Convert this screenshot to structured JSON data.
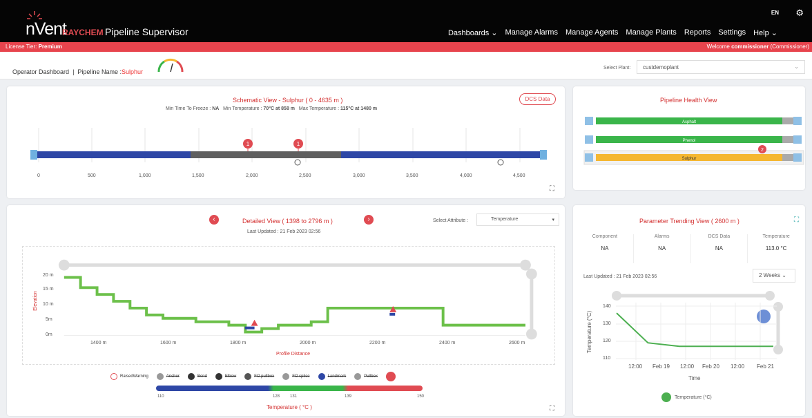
{
  "header": {
    "brand": "nVent",
    "raychem": "RAYCHEM",
    "product": "Pipeline Supervisor",
    "nav": [
      "Dashboards ⌄",
      "Manage Alarms",
      "Manage Agents",
      "Manage Plants",
      "Reports",
      "Settings",
      "Help ⌄"
    ],
    "lang": "EN"
  },
  "license": {
    "label": "License Tier:",
    "tier": "Premium",
    "welcome": "Welcome",
    "user": "commissioner",
    "role": "(Commissioner)"
  },
  "breadcrumb": {
    "dashboard": "Operator Dashboard",
    "sep": "|",
    "pipeline_label": "Pipeline Name :",
    "pipeline": "Sulphur"
  },
  "plant": {
    "label": "Select Plant:",
    "value": "custdemoplant"
  },
  "schematic": {
    "title": "Schematic View - Sulphur ( 0 - 4635 m )",
    "min_freeze_label": "Min Time To Freeze :",
    "min_freeze": "NA",
    "min_temp_label": "Min Temperature :",
    "min_temp": "70°C at 858 m",
    "max_temp_label": "Max Temperature :",
    "max_temp": "115°C at 1480 m",
    "dcs_button": "DCS Data",
    "ticks": [
      "0",
      "500",
      "1,000",
      "1,500",
      "2,000",
      "2,500",
      "3,000",
      "3,500",
      "4,000",
      "4,500"
    ],
    "alarm_badges": [
      "1",
      "1"
    ]
  },
  "health": {
    "title": "Pipeline Health View",
    "bars": [
      {
        "label": "Asphalt",
        "color": "#3ab54a"
      },
      {
        "label": "Phenol",
        "color": "#3ab54a"
      },
      {
        "label": "Sulphur",
        "color": "#f5b731",
        "alarms": "2"
      }
    ]
  },
  "detail": {
    "title": "Detailed View ( 1398 to 2796 m )",
    "updated": "Last Updated : 21 Feb 2023 02:56",
    "attr_label": "Select Attribute :",
    "attr_value": "Temperature",
    "y_ticks": [
      "20 m",
      "15 m",
      "10 m",
      "5m",
      "0m"
    ],
    "y_label": "Elevation",
    "x_ticks": [
      "1400 m",
      "1600 m",
      "1800 m",
      "2000 m",
      "2200 m",
      "2400 m",
      "2600 m"
    ],
    "x_label": "Profile Distance",
    "legend": [
      "RaisedWarning",
      "Anchor",
      "Bend",
      "Elbow",
      "FO pullbox",
      "FO splice",
      "Landmark",
      "Pullbox"
    ],
    "temp_scale": {
      "ticks": [
        "110",
        "128",
        "131",
        "139",
        "150"
      ],
      "label": "Temperature ( °C )"
    }
  },
  "trend": {
    "title": "Parameter Trending View ( 2600 m )",
    "columns": [
      {
        "head": "Component",
        "value": "NA"
      },
      {
        "head": "Alarms",
        "value": "NA"
      },
      {
        "head": "DCS Data",
        "value": "NA"
      },
      {
        "head": "Temperature",
        "value": "113.0 °C"
      }
    ],
    "updated": "Last Updated : 21 Feb 2023 02:56",
    "range": "2 Weeks",
    "y_ticks": [
      "140",
      "130",
      "120",
      "110"
    ],
    "y_label": "Temperature (°C)",
    "x_ticks": [
      "12:00",
      "Feb 19",
      "12:00",
      "Feb 20",
      "12:00",
      "Feb 21"
    ],
    "x_label": "Time",
    "legend": "Temperature (°C)"
  },
  "chart_data": [
    {
      "type": "line",
      "title": "Detailed View ( 1398 to 2796 m )",
      "xlabel": "Profile Distance",
      "ylabel": "Elevation",
      "xlim": [
        1300,
        2700
      ],
      "ylim": [
        0,
        20
      ],
      "series": [
        {
          "x": [
            1300,
            1350,
            1400,
            1450,
            1500,
            1550,
            1600,
            1650,
            1700,
            1750,
            1800,
            1850,
            1900,
            1950,
            2000,
            2050,
            2100,
            2150,
            2200,
            2250,
            2300,
            2350,
            2400,
            2450,
            2500,
            2550,
            2600,
            2650,
            2700
          ],
          "values": [
            17,
            14,
            12,
            10,
            8,
            6,
            5,
            5,
            4,
            4,
            3,
            1,
            2,
            3,
            3,
            4,
            8,
            8,
            8,
            8,
            8,
            8,
            8,
            3,
            3,
            3,
            3,
            3,
            3
          ]
        }
      ]
    },
    {
      "type": "line",
      "title": "Parameter Trending View ( 2600 m )",
      "xlabel": "Time",
      "ylabel": "Temperature (°C)",
      "ylim": [
        110,
        140
      ],
      "series": [
        {
          "name": "Temperature (°C)",
          "x": [
            "Feb 18 12:00",
            "Feb 19 00:00",
            "Feb 19 12:00",
            "Feb 20 00:00",
            "Feb 20 12:00",
            "Feb 21 00:00"
          ],
          "values": [
            136,
            119,
            117,
            117,
            117,
            117
          ]
        }
      ]
    }
  ]
}
